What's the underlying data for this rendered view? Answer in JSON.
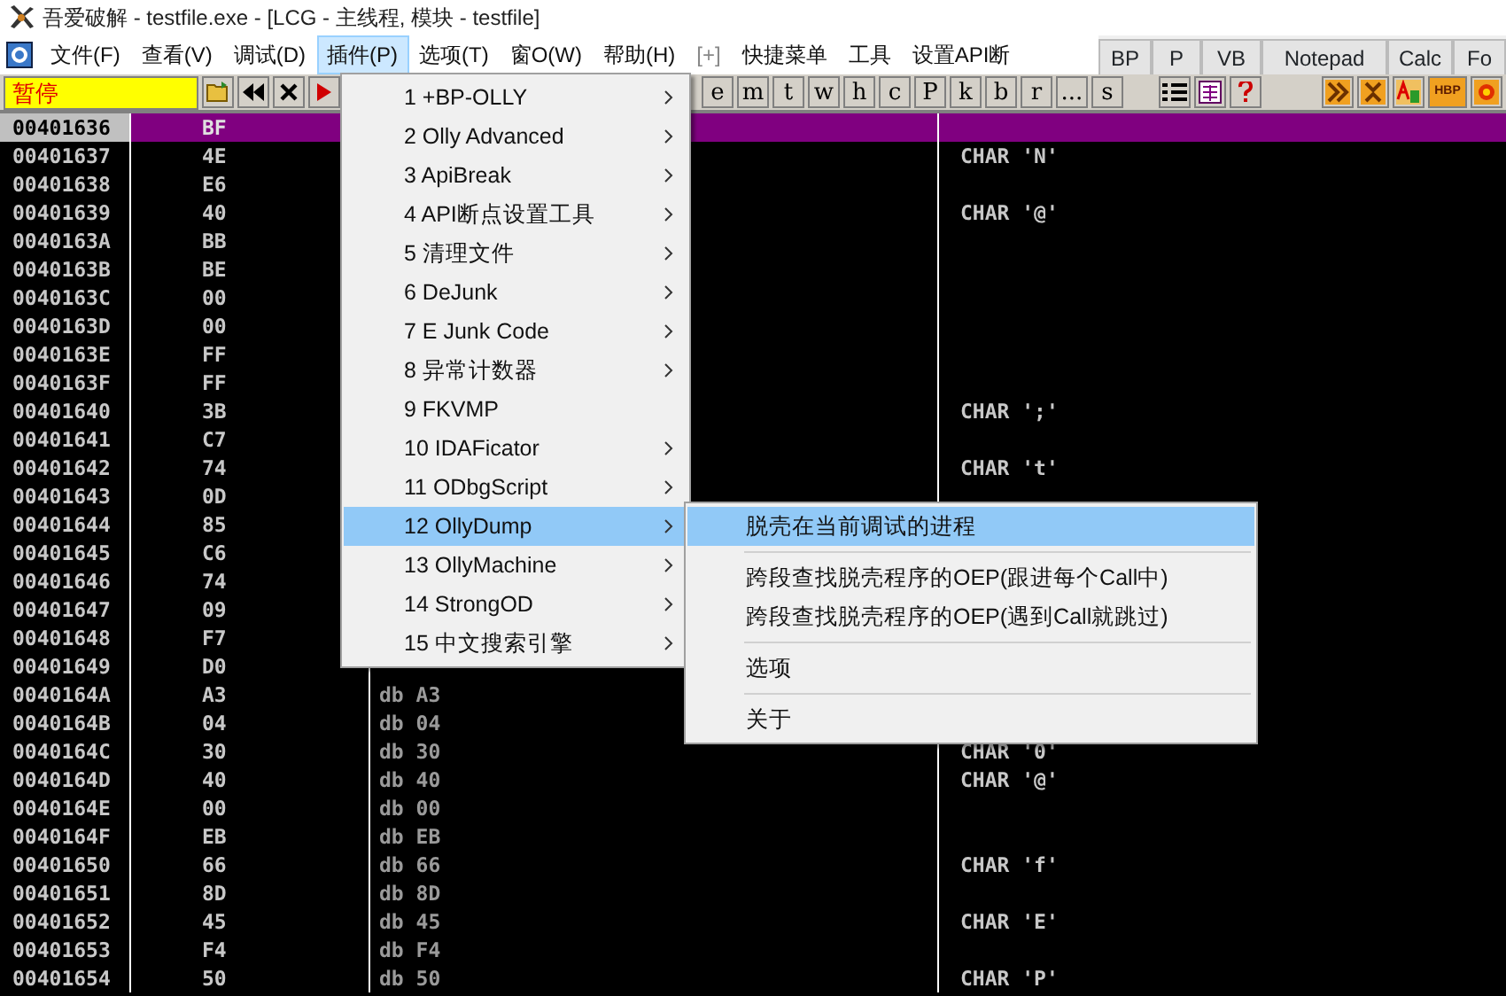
{
  "window": {
    "title": "吾爱破解 - testfile.exe - [LCG -  主线程, 模块 - testfile]"
  },
  "menu_bar": [
    {
      "label": "文件(F)",
      "selected": false,
      "disabled": false
    },
    {
      "label": "查看(V)",
      "selected": false,
      "disabled": false
    },
    {
      "label": "调试(D)",
      "selected": false,
      "disabled": false
    },
    {
      "label": "插件(P)",
      "selected": true,
      "disabled": false
    },
    {
      "label": "选项(T)",
      "selected": false,
      "disabled": false
    },
    {
      "label": "窗O(W)",
      "selected": false,
      "disabled": false
    },
    {
      "label": "帮助(H)",
      "selected": false,
      "disabled": false
    },
    {
      "label": "[+]",
      "selected": false,
      "disabled": true
    },
    {
      "label": "快捷菜单",
      "selected": false,
      "disabled": false
    },
    {
      "label": "工具",
      "selected": false,
      "disabled": false
    },
    {
      "label": "设置API断",
      "selected": false,
      "disabled": false
    }
  ],
  "tool_tabs": [
    "BP",
    "P",
    "VB",
    "Notepad",
    "Calc",
    "Fo"
  ],
  "toolbar": {
    "status": "暂停",
    "letter_buttons": [
      "e",
      "m",
      "t",
      "w",
      "h",
      "c",
      "P",
      "k",
      "b",
      "r",
      "...",
      "s"
    ],
    "hbp_label": "HBP"
  },
  "dump": {
    "rows": [
      {
        "address": "00401636",
        "hex": "BF",
        "selected": true
      },
      {
        "address": "00401637",
        "hex": "4E",
        "comment": "CHAR 'N'",
        "selected": false
      },
      {
        "address": "00401638",
        "hex": "E6",
        "selected": false
      },
      {
        "address": "00401639",
        "hex": "40",
        "comment": "CHAR '@'",
        "selected": false
      },
      {
        "address": "0040163A",
        "hex": "BB",
        "selected": false
      },
      {
        "address": "0040163B",
        "hex": "BE",
        "selected": false
      },
      {
        "address": "0040163C",
        "hex": "00",
        "selected": false
      },
      {
        "address": "0040163D",
        "hex": "00",
        "selected": false
      },
      {
        "address": "0040163E",
        "hex": "FF",
        "selected": false
      },
      {
        "address": "0040163F",
        "hex": "FF",
        "selected": false
      },
      {
        "address": "00401640",
        "hex": "3B",
        "comment": "CHAR ';'",
        "selected": false
      },
      {
        "address": "00401641",
        "hex": "C7",
        "selected": false
      },
      {
        "address": "00401642",
        "hex": "74",
        "comment": "CHAR 't'",
        "selected": false
      },
      {
        "address": "00401643",
        "hex": "0D",
        "selected": false
      },
      {
        "address": "00401644",
        "hex": "85",
        "selected": false
      },
      {
        "address": "00401645",
        "hex": "C6",
        "selected": false
      },
      {
        "address": "00401646",
        "hex": "74",
        "selected": false
      },
      {
        "address": "00401647",
        "hex": "09",
        "selected": false
      },
      {
        "address": "00401648",
        "hex": "F7",
        "selected": false
      },
      {
        "address": "00401649",
        "hex": "D0",
        "selected": false
      },
      {
        "address": "0040164A",
        "hex": "A3",
        "disasm": "db A3",
        "selected": false
      },
      {
        "address": "0040164B",
        "hex": "04",
        "disasm": "db 04",
        "selected": false
      },
      {
        "address": "0040164C",
        "hex": "30",
        "disasm": "db 30",
        "comment": "CHAR '0'",
        "selected": false
      },
      {
        "address": "0040164D",
        "hex": "40",
        "disasm": "db 40",
        "comment": "CHAR '@'",
        "selected": false
      },
      {
        "address": "0040164E",
        "hex": "00",
        "disasm": "db 00",
        "selected": false
      },
      {
        "address": "0040164F",
        "hex": "EB",
        "disasm": "db EB",
        "selected": false
      },
      {
        "address": "00401650",
        "hex": "66",
        "disasm": "db 66",
        "comment": "CHAR 'f'",
        "selected": false
      },
      {
        "address": "00401651",
        "hex": "8D",
        "disasm": "db 8D",
        "selected": false
      },
      {
        "address": "00401652",
        "hex": "45",
        "disasm": "db 45",
        "comment": "CHAR 'E'",
        "selected": false
      },
      {
        "address": "00401653",
        "hex": "F4",
        "disasm": "db F4",
        "selected": false
      },
      {
        "address": "00401654",
        "hex": "50",
        "disasm": "db 50",
        "comment": "CHAR 'P'",
        "selected": false
      }
    ]
  },
  "plugin_menu": {
    "items": [
      {
        "label": "1 +BP-OLLY",
        "has_submenu": true,
        "selected": false
      },
      {
        "label": "2 Olly Advanced",
        "has_submenu": true,
        "selected": false
      },
      {
        "label": "3 ApiBreak",
        "has_submenu": true,
        "selected": false
      },
      {
        "label": "4 API断点设置工具",
        "has_submenu": true,
        "selected": false
      },
      {
        "label": "5 清理文件",
        "has_submenu": true,
        "selected": false
      },
      {
        "label": "6 DeJunk",
        "has_submenu": true,
        "selected": false
      },
      {
        "label": "7 E Junk Code",
        "has_submenu": true,
        "selected": false
      },
      {
        "label": "8 异常计数器",
        "has_submenu": true,
        "selected": false
      },
      {
        "label": "9 FKVMP",
        "has_submenu": false,
        "selected": false
      },
      {
        "label": "10 IDAFicator",
        "has_submenu": true,
        "selected": false
      },
      {
        "label": "11 ODbgScript",
        "has_submenu": true,
        "selected": false
      },
      {
        "label": "12 OllyDump",
        "has_submenu": true,
        "selected": true
      },
      {
        "label": "13 OllyMachine",
        "has_submenu": true,
        "selected": false
      },
      {
        "label": "14 StrongOD",
        "has_submenu": true,
        "selected": false
      },
      {
        "label": "15 中文搜索引擎",
        "has_submenu": true,
        "selected": false
      }
    ]
  },
  "submenu": {
    "items": [
      {
        "kind": "item",
        "label": "脱壳在当前调试的进程",
        "selected": true
      },
      {
        "kind": "separator"
      },
      {
        "kind": "item",
        "label": "跨段查找脱壳程序的OEP(跟进每个Call中)",
        "selected": false
      },
      {
        "kind": "item",
        "label": "跨段查找脱壳程序的OEP(遇到Call就跳过)",
        "selected": false
      },
      {
        "kind": "separator"
      },
      {
        "kind": "item",
        "label": "选项",
        "selected": false
      },
      {
        "kind": "separator"
      },
      {
        "kind": "item",
        "label": "关于",
        "selected": false
      }
    ]
  }
}
